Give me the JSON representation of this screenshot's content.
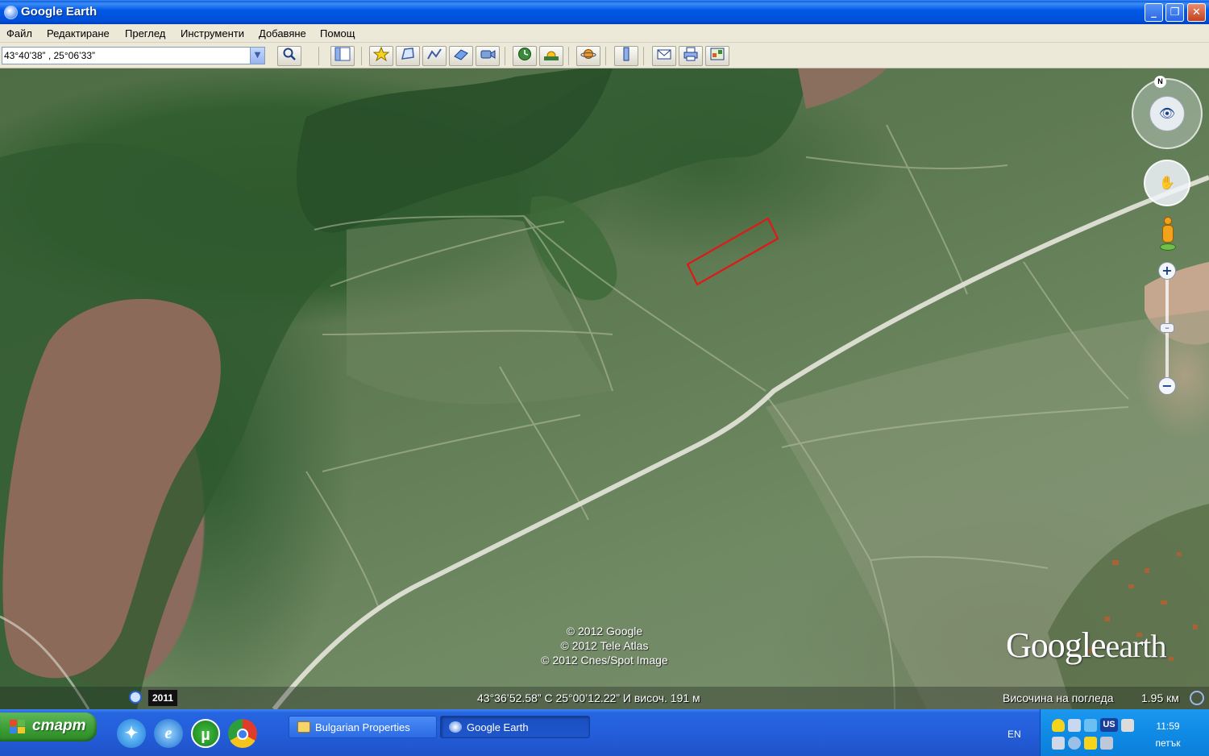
{
  "window": {
    "title": "Google Earth",
    "minimize": "_",
    "maximize": "❐",
    "close": "✕"
  },
  "menu": [
    "Файл",
    "Редактиране",
    "Преглед",
    "Инструменти",
    "Добавяне",
    "Помощ"
  ],
  "search": {
    "value": "43°40’38” , 25°06’33”",
    "dropdown_glyph": "▼"
  },
  "toolbar": {
    "icons": [
      "sidebar-icon",
      "placemark-icon",
      "polygon-icon",
      "path-icon",
      "image-overlay-icon",
      "record-tour-icon",
      "historical-imagery-icon",
      "sunlight-icon",
      "planets-icon",
      "ruler-icon",
      "email-icon",
      "print-icon",
      "view-in-maps-icon"
    ]
  },
  "map": {
    "copyright": [
      "© 2012 Google",
      "© 2012 Tele Atlas",
      "© 2012 Cnes/Spot Image"
    ],
    "logo_google": "Google",
    "logo_earth": "earth",
    "selection_color": "#e01818"
  },
  "status": {
    "imagery_year": "2011",
    "coordinates": "43°36’52.58” С  25°00’12.22” И височ.  191 м",
    "eye_alt_label": "Височина на погледа",
    "eye_alt_value": "1.95 км"
  },
  "nav": {
    "north": "N",
    "zoom_in": "+",
    "zoom_out": "−"
  },
  "taskbar": {
    "start": "старт",
    "tasks": [
      "Bulgarian Properties",
      "Google Earth"
    ],
    "lang": "EN",
    "tray_label": "US",
    "time": "11:59",
    "day": "петък"
  }
}
